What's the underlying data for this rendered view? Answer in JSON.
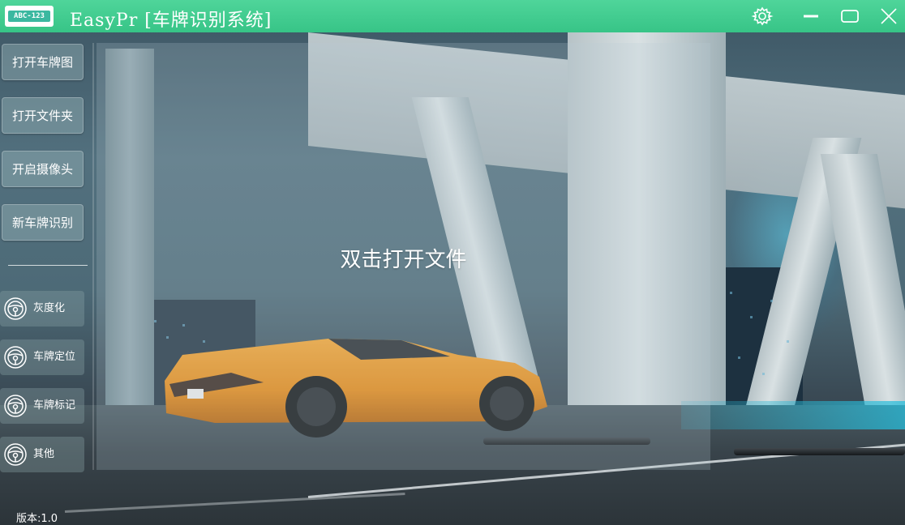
{
  "window": {
    "logo_text": "ABC-123",
    "title": "EasyPr [车牌识别系统]",
    "titlebar_color": "#3fcc8c"
  },
  "titlebar_icons": [
    "gear-icon",
    "minimize-icon",
    "maximize-icon",
    "close-icon"
  ],
  "sidebar": {
    "buttons": [
      {
        "label": "打开车牌图"
      },
      {
        "label": "打开文件夹"
      },
      {
        "label": "开启摄像头"
      },
      {
        "label": "新车牌识别"
      }
    ],
    "tools": [
      {
        "label": "灰度化",
        "icon": "steering-wheel-icon"
      },
      {
        "label": "车牌定位",
        "icon": "steering-wheel-icon"
      },
      {
        "label": "车牌标记",
        "icon": "steering-wheel-icon"
      },
      {
        "label": "其他",
        "icon": "steering-wheel-icon"
      }
    ]
  },
  "main": {
    "hint": "双击打开文件"
  },
  "status": {
    "version": "版本:1.0"
  }
}
